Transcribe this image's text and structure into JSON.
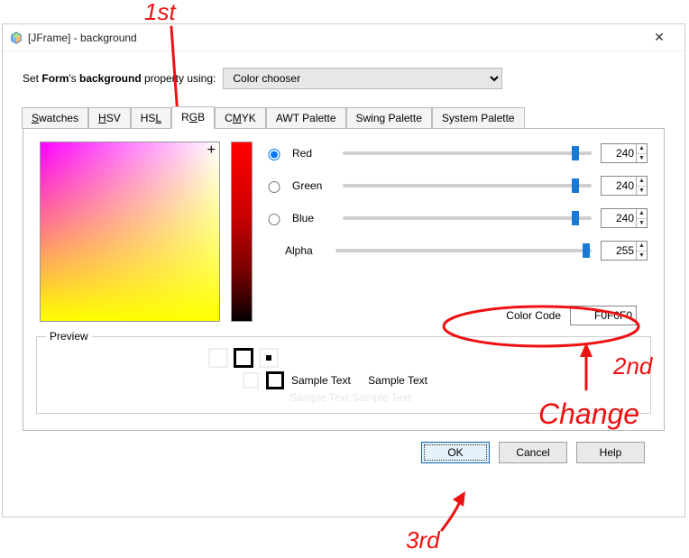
{
  "window": {
    "title": "[JFrame] - background"
  },
  "header": {
    "prefix": "Set ",
    "form_word": "Form",
    "poss": "'s ",
    "prop": "background",
    "suffix": " property using:",
    "selector_value": "Color chooser"
  },
  "tabs": [
    {
      "label": "Swatches",
      "mnemonic": "S",
      "rest": "watches"
    },
    {
      "label": "HSV",
      "mnemonic": "H",
      "rest": "SV"
    },
    {
      "label": "HSL",
      "mnemonic": "",
      "rest": "HS",
      "trail_m": "L"
    },
    {
      "label": "RGB",
      "mnemonic": "G",
      "pre": "R",
      "rest": "B",
      "active": true
    },
    {
      "label": "CMYK",
      "mnemonic": "M",
      "pre": "C",
      "rest": "YK"
    },
    {
      "label": "AWT Palette"
    },
    {
      "label": "Swing Palette"
    },
    {
      "label": "System Palette"
    }
  ],
  "channels": {
    "red": {
      "label": "Red",
      "value": "240"
    },
    "green": {
      "label": "Green",
      "value": "240"
    },
    "blue": {
      "label": "Blue",
      "value": "240"
    },
    "alpha": {
      "label": "Alpha",
      "value": "255"
    }
  },
  "colorcode": {
    "label": "Color Code",
    "value": "F0F0F0"
  },
  "preview": {
    "legend": "Preview",
    "sample": "Sample Text",
    "sample_ghost": "Sample Text  Sample Text"
  },
  "buttons": {
    "ok": "OK",
    "cancel": "Cancel",
    "help": "Help"
  },
  "annotations": {
    "first": "1st",
    "second": "2nd",
    "third": "3rd",
    "change": "Change"
  }
}
